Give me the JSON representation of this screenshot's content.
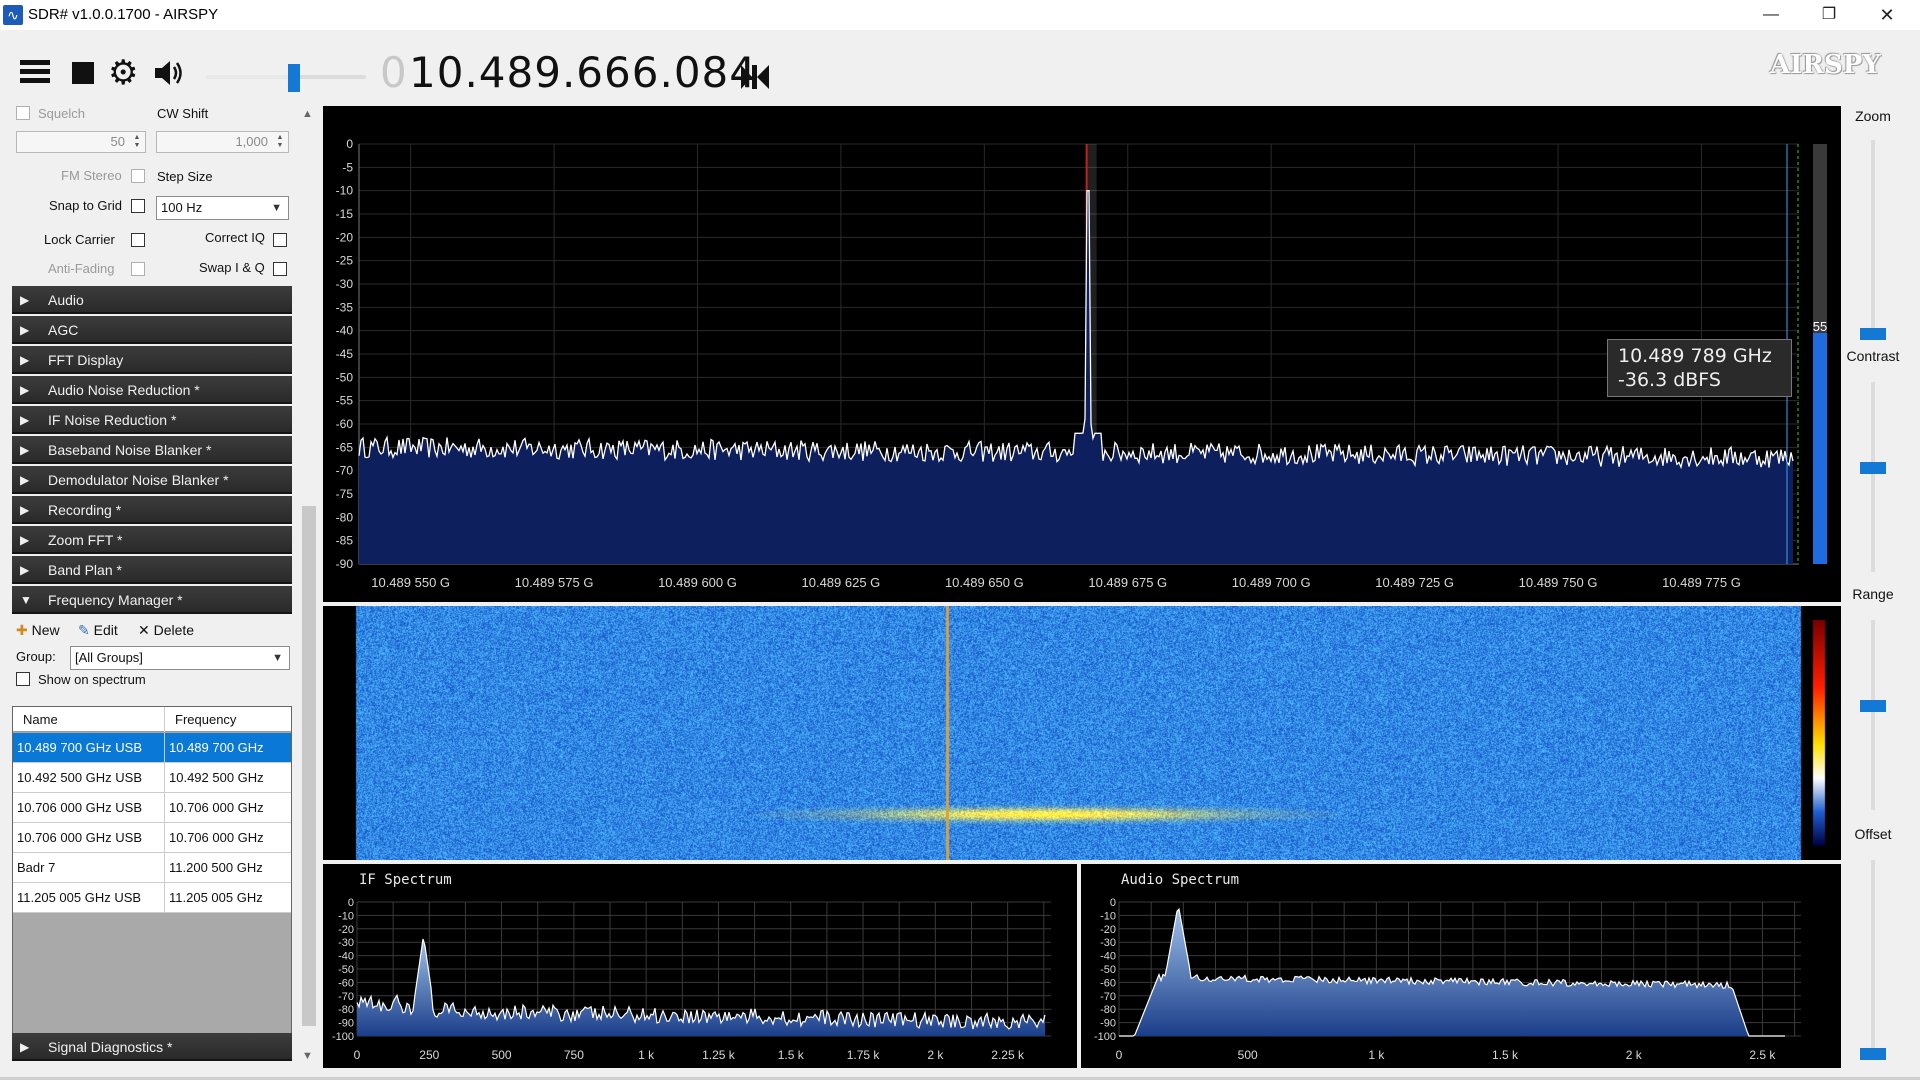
{
  "window": {
    "title": "SDR# v1.0.0.1700 - AIRSPY",
    "minimize": "—",
    "maximize": "❐",
    "close": "✕"
  },
  "toolbar": {
    "volume_level": 0.55,
    "frequency_leading_zero": "0",
    "frequency": "10.489.666.084",
    "logo": "AIRSPY"
  },
  "radio": {
    "squelch_label": "Squelch",
    "squelch_value": "50",
    "cw_shift_label": "CW Shift",
    "cw_shift_value": "1,000",
    "fm_stereo_label": "FM Stereo",
    "step_size_label": "Step Size",
    "snap_to_grid_label": "Snap to Grid",
    "step_size_value": "100 Hz",
    "lock_carrier_label": "Lock Carrier",
    "correct_iq_label": "Correct IQ",
    "anti_fading_label": "Anti-Fading",
    "swap_iq_label": "Swap I & Q"
  },
  "sections": [
    "Audio",
    "AGC",
    "FFT Display",
    "Audio Noise Reduction *",
    "IF Noise Reduction *",
    "Baseband Noise Blanker *",
    "Demodulator Noise Blanker *",
    "Recording *",
    "Zoom FFT *",
    "Band Plan *",
    "Frequency Manager *"
  ],
  "freq_manager": {
    "new_label": "New",
    "edit_label": "Edit",
    "delete_label": "Delete",
    "group_label": "Group:",
    "group_value": "[All Groups]",
    "show_on_spectrum_label": "Show on spectrum",
    "col_name": "Name",
    "col_frequency": "Frequency",
    "rows": [
      {
        "name": "10.489 700 GHz USB",
        "frequency": "10.489 700 GHz",
        "selected": true
      },
      {
        "name": "10.492 500 GHz USB",
        "frequency": "10.492 500 GHz",
        "selected": false
      },
      {
        "name": "10.706 000 GHz USB",
        "frequency": "10.706 000 GHz",
        "selected": false
      },
      {
        "name": "10.706 000 GHz USB",
        "frequency": "10.706 000 GHz",
        "selected": false
      },
      {
        "name": "Badr 7",
        "frequency": "11.200 500 GHz",
        "selected": false
      },
      {
        "name": "11.205 005 GHz USB",
        "frequency": "11.205 005 GHz",
        "selected": false
      }
    ]
  },
  "signal_diagnostics_label": "Signal Diagnostics *",
  "spectrum": {
    "y_ticks": [
      "0",
      "-5",
      "-10",
      "-15",
      "-20",
      "-25",
      "-30",
      "-35",
      "-40",
      "-45",
      "-50",
      "-55",
      "-60",
      "-65",
      "-70",
      "-75",
      "-80",
      "-85",
      "-90"
    ],
    "x_ticks": [
      "10.489 550 G",
      "10.489 575 G",
      "10.489 600 G",
      "10.489 625 G",
      "10.489 650 G",
      "10.489 675 G",
      "10.489 700 G",
      "10.489 725 G",
      "10.489 750 G",
      "10.489 775 G"
    ],
    "x_range": [
      10.489541,
      10.489792
    ],
    "y_range": [
      -90,
      0
    ],
    "noise_floor_db": -65,
    "peak_freq": 10.489668,
    "peak_db": -10,
    "tooltip_freq": "10.489 789 GHz",
    "tooltip_level": "-36.3 dBFS",
    "snr_label": "55",
    "snr_level": 0.55
  },
  "if_spectrum": {
    "title": "IF Spectrum",
    "y_ticks": [
      "0",
      "-10",
      "-20",
      "-30",
      "-40",
      "-50",
      "-60",
      "-70",
      "-80",
      "-90",
      "-100"
    ],
    "x_ticks": [
      "0",
      "250",
      "500",
      "750",
      "1 k",
      "1.25 k",
      "1.5 k",
      "1.75 k",
      "2 k",
      "2.25 k"
    ],
    "x_range": [
      0,
      2400
    ],
    "y_range": [
      -100,
      0
    ],
    "peak_x": 230,
    "peak_db": -25
  },
  "audio_spectrum": {
    "title": "Audio Spectrum",
    "y_ticks": [
      "0",
      "-10",
      "-20",
      "-30",
      "-40",
      "-50",
      "-60",
      "-70",
      "-80",
      "-90",
      "-100"
    ],
    "x_ticks": [
      "0",
      "500",
      "1 k",
      "1.5 k",
      "2 k",
      "2.5 k"
    ],
    "x_range": [
      0,
      2650
    ],
    "y_range": [
      -100,
      0
    ],
    "peak_x": 230,
    "peak_db": -2
  },
  "right_sliders": {
    "zoom_label": "Zoom",
    "zoom_level": 0.0,
    "contrast_label": "Contrast",
    "contrast_level": 0.55,
    "range_label": "Range",
    "range_level": 0.55,
    "offset_label": "Offset",
    "offset_level": 0.0
  },
  "colors": {
    "accent": "#0a78d7",
    "spectrum_fill": "#0d1f5c",
    "trace": "#ffffff",
    "waterfall": "#1f5fd0",
    "tuned_line": "#c22020"
  }
}
